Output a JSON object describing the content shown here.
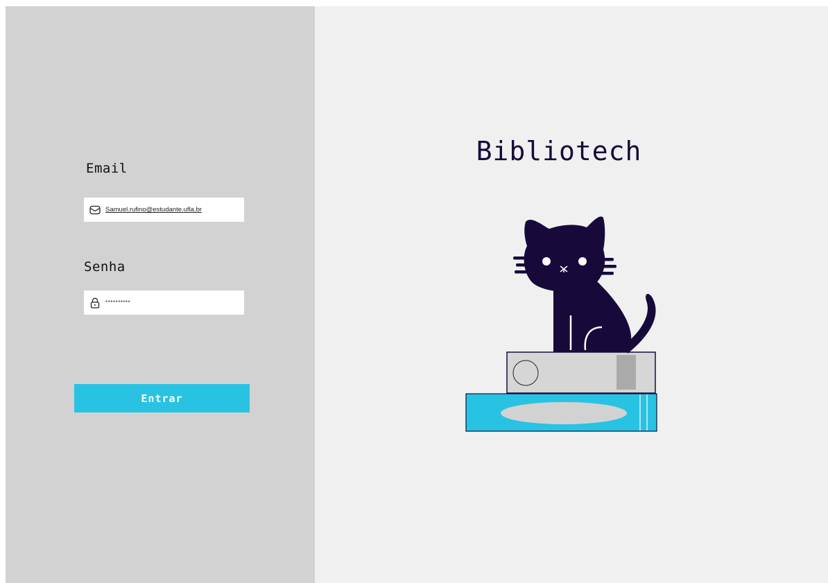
{
  "form": {
    "email_label": "Email",
    "email_value": "Samuel.rufino@estudante.ufla.br",
    "password_label": "Senha",
    "password_value": "**********",
    "submit_label": "Entrar"
  },
  "brand": {
    "title": "Bibliotech"
  },
  "icons": {
    "email": "mail-icon",
    "password": "lock-icon"
  },
  "colors": {
    "left_panel": "#d2d2d3",
    "right_panel": "#f0f0f1",
    "accent": "#28c3e2",
    "title": "#170a3a",
    "cat": "#170a3a"
  }
}
